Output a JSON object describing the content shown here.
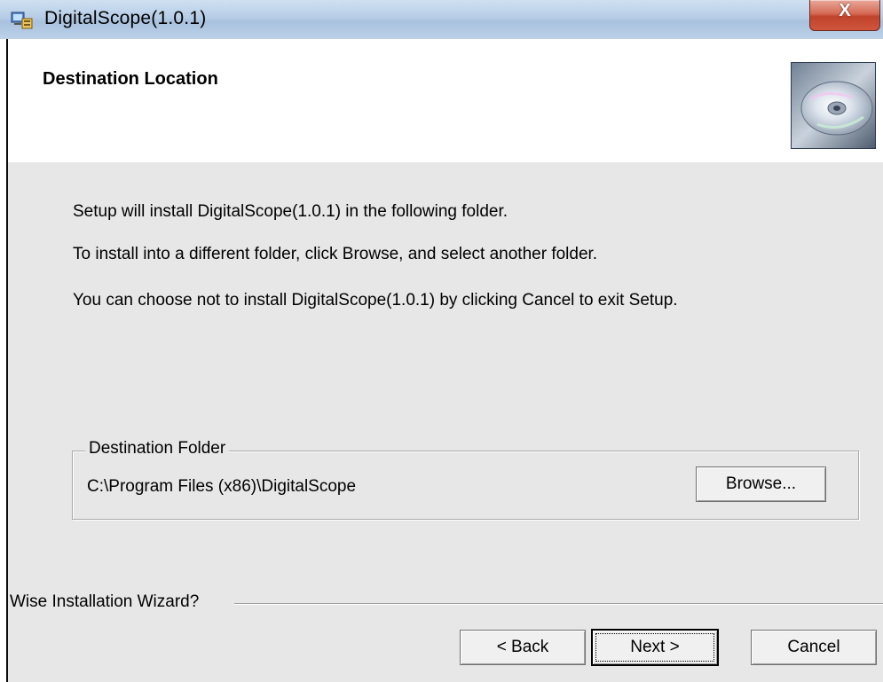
{
  "window": {
    "title": "DigitalScope(1.0.1)",
    "close_glyph": "X",
    "icon": "setup-app-icon"
  },
  "header": {
    "title": "Destination Location",
    "icon": "cd-disc-icon"
  },
  "body": {
    "line1": "Setup will install DigitalScope(1.0.1) in the following folder.",
    "line2": "To install into a different folder, click Browse, and select another folder.",
    "line3": "You can choose not to install DigitalScope(1.0.1) by clicking Cancel to exit Setup."
  },
  "destination": {
    "group_label": "Destination Folder",
    "path": "C:\\Program Files (x86)\\DigitalScope",
    "browse_label": "Browse..."
  },
  "footer": {
    "wizard_label": "Wise Installation Wizard?",
    "back_label": "< Back",
    "next_label": "Next >",
    "cancel_label": "Cancel"
  }
}
